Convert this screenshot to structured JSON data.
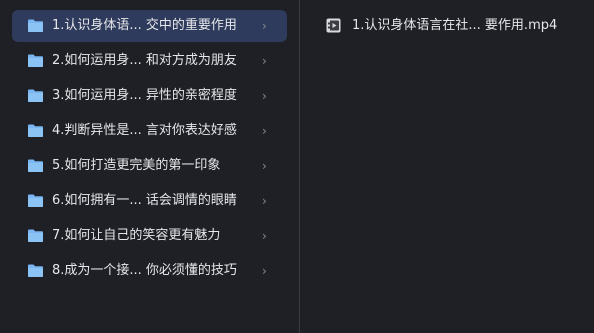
{
  "folders": [
    {
      "label": "1.认识身体语...  交中的重要作用",
      "selected": true
    },
    {
      "label": "2.如何运用身...  和对方成为朋友",
      "selected": false
    },
    {
      "label": "3.如何运用身...  异性的亲密程度",
      "selected": false
    },
    {
      "label": "4.判断异性是...  言对你表达好感",
      "selected": false
    },
    {
      "label": "5.如何打造更完美的第一印象",
      "selected": false
    },
    {
      "label": "6.如何拥有一...  话会调情的眼睛",
      "selected": false
    },
    {
      "label": "7.如何让自己的笑容更有魅力",
      "selected": false
    },
    {
      "label": "8.成为一个接...  你必须懂的技巧",
      "selected": false
    }
  ],
  "chevron_glyph": "›",
  "files": [
    {
      "label": "1.认识身体语言在社...  要作用.mp4",
      "icon": "video-file-icon"
    }
  ],
  "colors": {
    "background": "#1f2025",
    "selected_row": "#2e3b5c",
    "folder_icon": "#79b6f2",
    "text": "#e6e7ea"
  }
}
